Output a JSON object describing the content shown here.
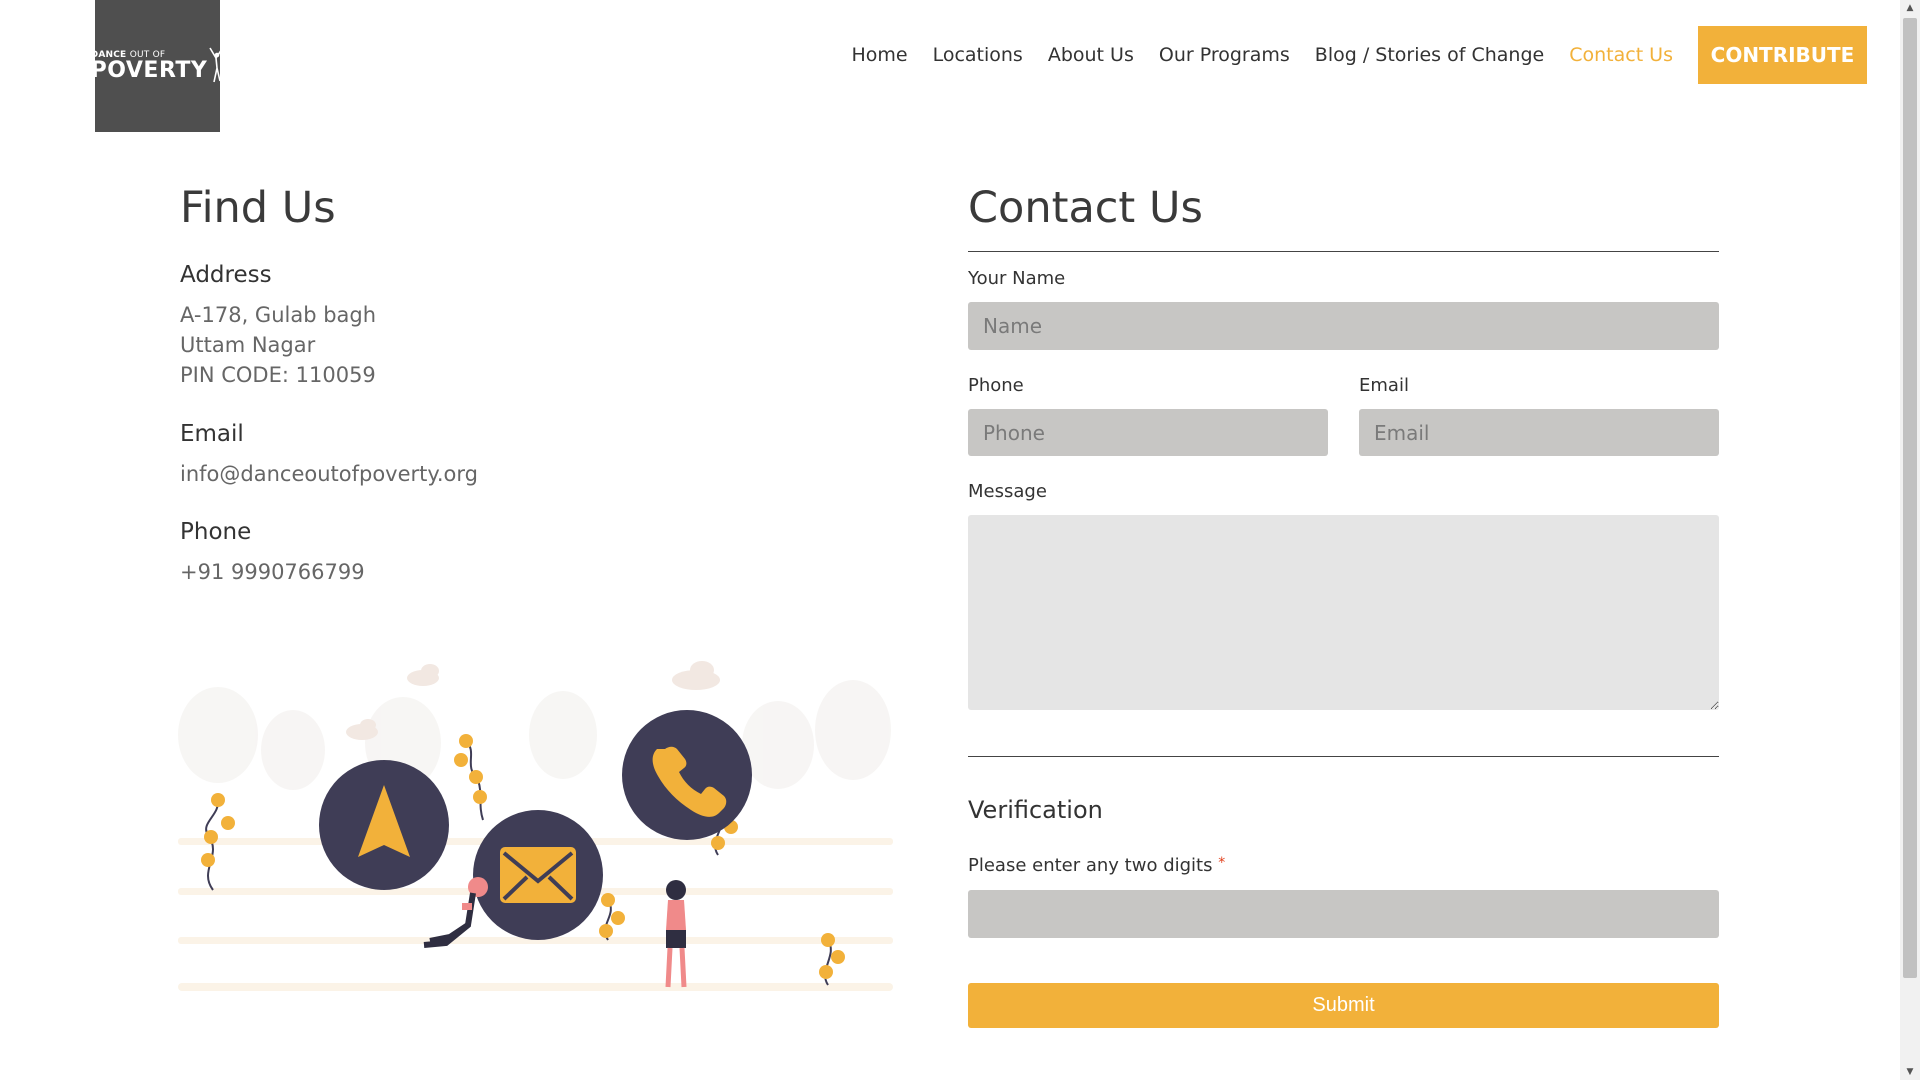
{
  "header": {
    "logo": {
      "line1_bold": "DANCE",
      "line1_thin": "OUT OF",
      "line2": "POVERTY"
    },
    "nav": [
      {
        "label": "Home",
        "active": false
      },
      {
        "label": "Locations",
        "active": false
      },
      {
        "label": "About Us",
        "active": false
      },
      {
        "label": "Our Programs",
        "active": false
      },
      {
        "label": "Blog / Stories of Change",
        "active": false
      },
      {
        "label": "Contact Us",
        "active": true
      }
    ],
    "cta_label": "CONTRIBUTE"
  },
  "find_us": {
    "title": "Find Us",
    "address_label": "Address",
    "address_lines": [
      "A-178, Gulab bagh",
      "Uttam Nagar",
      "PIN CODE: 110059"
    ],
    "email_label": "Email",
    "email": "info@danceoutofpoverty.org",
    "phone_label": "Phone",
    "phone": "+91 9990766799"
  },
  "contact_form": {
    "title": "Contact Us",
    "name_label": "Your Name",
    "name_placeholder": "Name",
    "phone_label": "Phone",
    "phone_placeholder": "Phone",
    "email_label": "Email",
    "email_placeholder": "Email",
    "message_label": "Message",
    "message_value": "",
    "verification_title": "Verification",
    "verification_label": "Please enter any two digits",
    "required_mark": "*",
    "submit_label": "Submit"
  },
  "colors": {
    "accent": "#f2b13a",
    "logo_bg": "#4f4f4f",
    "input_bg": "#c7c6c4",
    "textarea_bg": "#e5e5e5",
    "illustration_circle": "#3f3d56",
    "figure_accent": "#f08a8a"
  },
  "icons": {
    "navigation": "location-arrow-icon",
    "mail": "envelope-icon",
    "phone": "phone-icon"
  }
}
